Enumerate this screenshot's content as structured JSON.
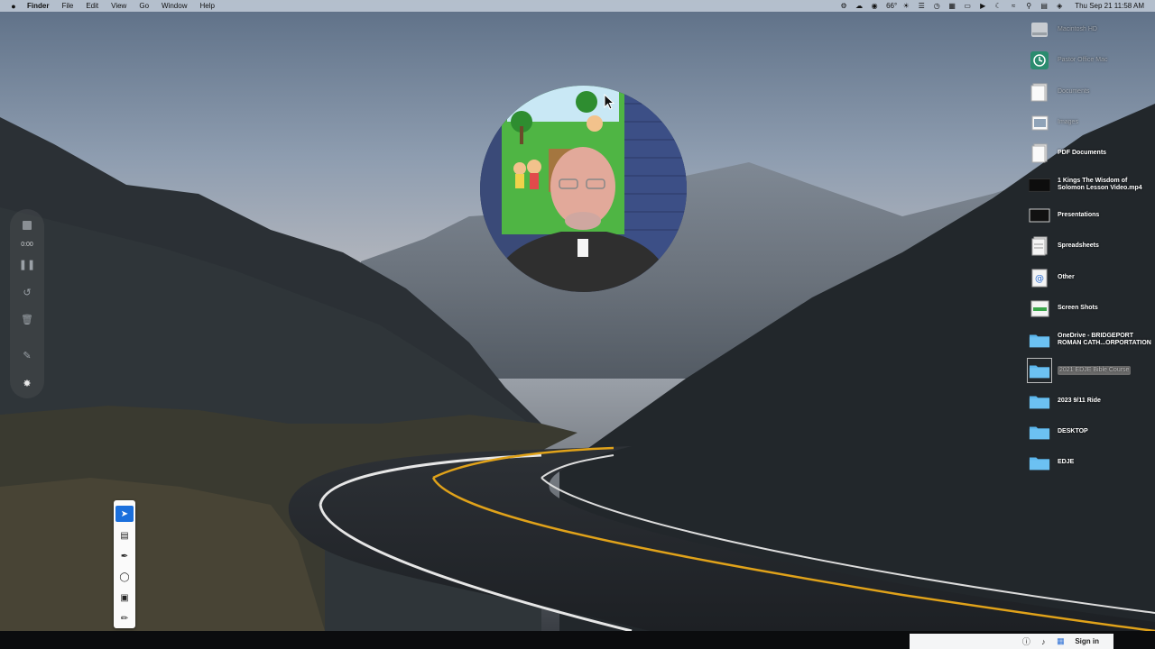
{
  "menubar": {
    "app_name": "Finder",
    "menus": [
      "File",
      "Edit",
      "View",
      "Go",
      "Window",
      "Help"
    ],
    "weather": "66°",
    "clock": "Thu Sep 21  11:58 AM"
  },
  "desktop_icons": [
    {
      "label": "Macintosh HD",
      "icon": "hard-drive-icon",
      "dim": true
    },
    {
      "label": "Pastor Office Mac",
      "icon": "time-machine-icon",
      "dim": true
    },
    {
      "label": "Documents",
      "icon": "document-stack-icon",
      "dim": true
    },
    {
      "label": "Images",
      "icon": "image-stack-icon",
      "dim": true
    },
    {
      "label": "PDF Documents",
      "icon": "pdf-stack-icon"
    },
    {
      "label": "1 Kings The Wisdom of\nSolomon Lesson Video.mp4",
      "icon": "video-file-icon"
    },
    {
      "label": "Presentations",
      "icon": "presentation-stack-icon"
    },
    {
      "label": "Spreadsheets",
      "icon": "spreadsheet-stack-icon"
    },
    {
      "label": "Other",
      "icon": "other-stack-icon"
    },
    {
      "label": "Screen Shots",
      "icon": "screenshot-stack-icon"
    },
    {
      "label": "OneDrive - BRIDGEPORT\nROMAN CATH...ORPORTATION",
      "icon": "folder-icon"
    },
    {
      "label": "2021 EDJE Bible Course",
      "icon": "folder-icon",
      "selected": true
    },
    {
      "label": "2023 9/11 Ride",
      "icon": "folder-icon"
    },
    {
      "label": "DESKTOP",
      "icon": "folder-icon"
    },
    {
      "label": "EDJE",
      "icon": "folder-icon"
    }
  ],
  "recording": {
    "timer": "0:00"
  },
  "bottom_bar": {
    "signin_label": "Sign in"
  },
  "colors": {
    "folder": "#5bb6ec",
    "menubar": "#bcc6d2",
    "accent": "#1a6fdc"
  }
}
